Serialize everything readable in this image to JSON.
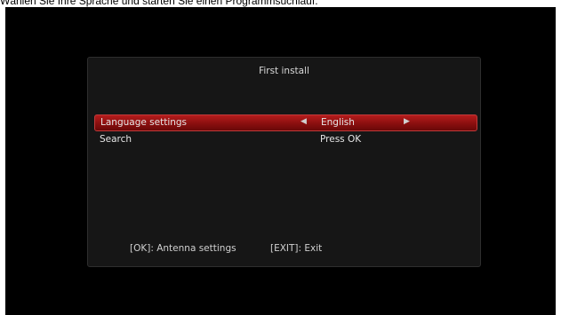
{
  "caption": "Wählen Sie Ihre Sprache und starten Sie einen Programmsuchlauf.",
  "dialog": {
    "title": "First install",
    "rows": [
      {
        "label": "Language settings",
        "value": "English",
        "left_arrow": "◀",
        "right_arrow": "▶",
        "selected": true
      },
      {
        "label": "Search",
        "value": "Press OK",
        "selected": false
      }
    ],
    "footer": {
      "ok_hint": "[OK]: Antenna settings",
      "exit_hint": "[EXIT]: Exit"
    }
  },
  "colors": {
    "selection": "#a01414",
    "background": "#000000",
    "panel": "#161616"
  }
}
